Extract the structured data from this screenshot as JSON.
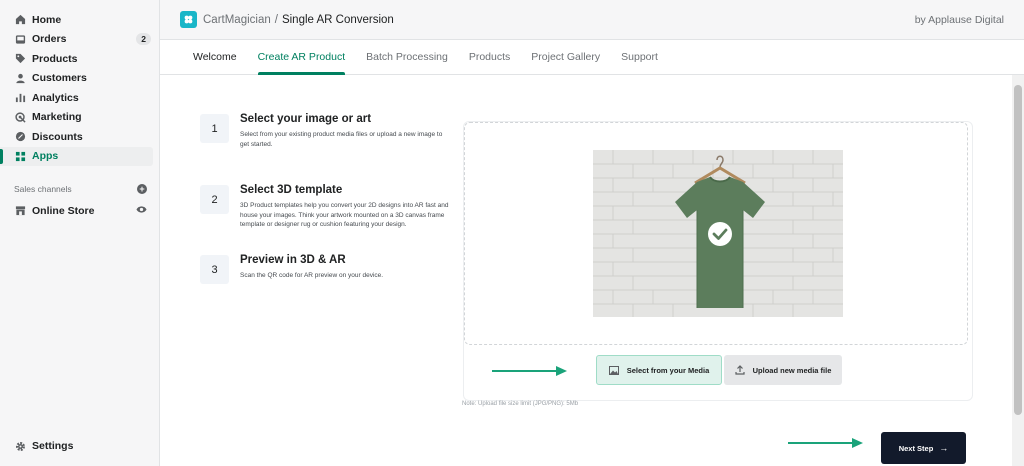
{
  "sidebar": {
    "items": [
      {
        "label": "Home",
        "icon": "home-icon"
      },
      {
        "label": "Orders",
        "icon": "orders-icon",
        "count": "2"
      },
      {
        "label": "Products",
        "icon": "tag-icon"
      },
      {
        "label": "Customers",
        "icon": "person-icon"
      },
      {
        "label": "Analytics",
        "icon": "bar-chart-icon"
      },
      {
        "label": "Marketing",
        "icon": "target-icon"
      },
      {
        "label": "Discounts",
        "icon": "discount-icon"
      },
      {
        "label": "Apps",
        "icon": "apps-icon",
        "active": true
      }
    ],
    "sales_channels_label": "Sales channels",
    "online_store_label": "Online Store",
    "settings_label": "Settings"
  },
  "header": {
    "app_name": "CartMagician",
    "separator": "/",
    "page_title": "Single AR Conversion",
    "by_line": "by Applause Digital"
  },
  "tabs": [
    {
      "label": "Welcome"
    },
    {
      "label": "Create AR Product",
      "active": true
    },
    {
      "label": "Batch Processing"
    },
    {
      "label": "Products"
    },
    {
      "label": "Project Gallery"
    },
    {
      "label": "Support"
    }
  ],
  "steps": [
    {
      "number": "1",
      "title": "Select your image or art",
      "description": "Select from your existing product media files or upload a new image to get started."
    },
    {
      "number": "2",
      "title": "Select 3D template",
      "description": "3D Product templates help you convert your 2D designs into AR fast and house your images. Think your artwork mounted on a 3D canvas frame template or designer rug or cushion featuring your design."
    },
    {
      "number": "3",
      "title": "Preview in 3D & AR",
      "description": "Scan the QR code for AR preview on your device."
    }
  ],
  "media": {
    "select_media_label": "Select from your Media",
    "upload_label": "Upload new media file",
    "note": "Note: Upload file size limit (JPG/PNG): 5Mb"
  },
  "next_step_label": "Next Step",
  "colors": {
    "accent": "#008060",
    "next_button": "#121a2b",
    "arrow": "#1aa37a"
  }
}
